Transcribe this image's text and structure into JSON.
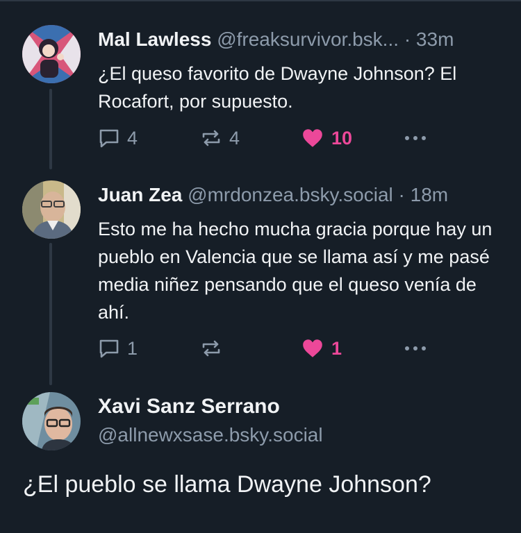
{
  "posts": [
    {
      "name": "Mal Lawless",
      "handle": "@freaksurvivor.bsk...",
      "separator": "·",
      "time": "33m",
      "text": "¿El queso favorito de Dwayne Johnson? El Rocafort, por supuesto.",
      "replies": "4",
      "reposts": "4",
      "likes": "10",
      "liked": true,
      "avatar_icon": "avatar-illustrated-character"
    },
    {
      "name": "Juan Zea",
      "handle": "@mrdonzea.bsky.social",
      "separator": "·",
      "time": "18m",
      "text": "Esto me ha hecho mucha gracia porque hay un pueblo en Valencia que se llama así y me pasé media niñez pensando que el queso venía de ahí.",
      "replies": "1",
      "reposts": "",
      "likes": "1",
      "liked": true,
      "avatar_icon": "avatar-photo-man-glasses"
    }
  ],
  "focused_post": {
    "name": "Xavi Sanz Serrano",
    "handle": "@allnewxsase.bsky.social",
    "text": "¿El pueblo se llama Dwayne Johnson?",
    "avatar_icon": "avatar-photo-man-glasses-selfie"
  },
  "colors": {
    "background": "#161e27",
    "text": "#f1f3f5",
    "muted": "#8d9bab",
    "like": "#ec4899",
    "thread_line": "#2e3844"
  }
}
